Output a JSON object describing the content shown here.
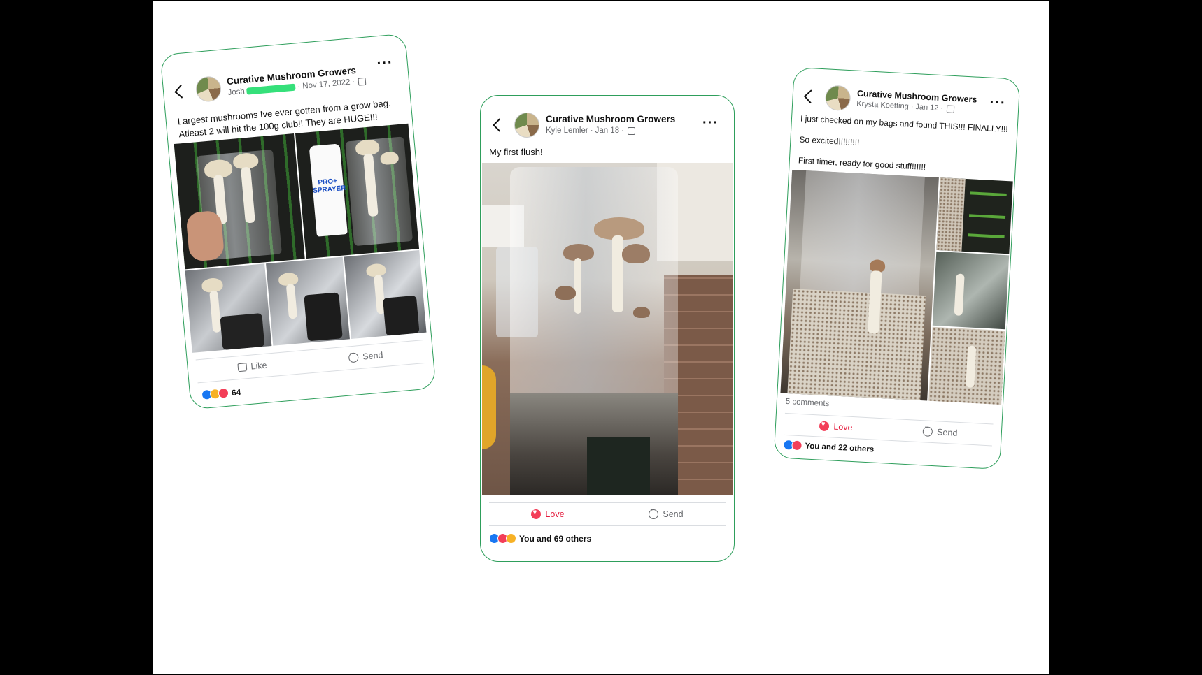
{
  "posts": [
    {
      "group": "Curative Mushroom Growers",
      "author": "Josh",
      "date": "Nov 17, 2022",
      "text_line1": "Largest mushrooms Ive ever gotten from a grow bag.",
      "text_line2": "Atleast 2 will hit the 100g club!! They are HUGE!!!",
      "sprayer_label": "PRO+ SPRAYER",
      "action_primary": "Like",
      "action_secondary": "Send",
      "reaction_count": "64",
      "reactions": [
        "like",
        "wow",
        "love"
      ]
    },
    {
      "group": "Curative Mushroom Growers",
      "author": "Kyle Lemler",
      "date": "Jan 18",
      "text": "My first flush!",
      "action_primary": "Love",
      "action_secondary": "Send",
      "reaction_count": "You and 69 others",
      "reactions": [
        "like",
        "love",
        "wow"
      ]
    },
    {
      "group": "Curative Mushroom Growers",
      "author": "Krysta Koetting",
      "date": "Jan 12",
      "text_line1": "I just checked on my bags and found THIS!!! FINALLY!!!",
      "text_line2": "So excited!!!!!!!!!",
      "text_line3": "First timer, ready for good stuff!!!!!!",
      "comments": "5 comments",
      "action_primary": "Love",
      "action_secondary": "Send",
      "reaction_count": "You and 22 others",
      "reactions": [
        "like",
        "love"
      ]
    }
  ],
  "colors": {
    "border": "#2e9e5b",
    "love": "#e41e3f",
    "like": "#1877f2"
  }
}
